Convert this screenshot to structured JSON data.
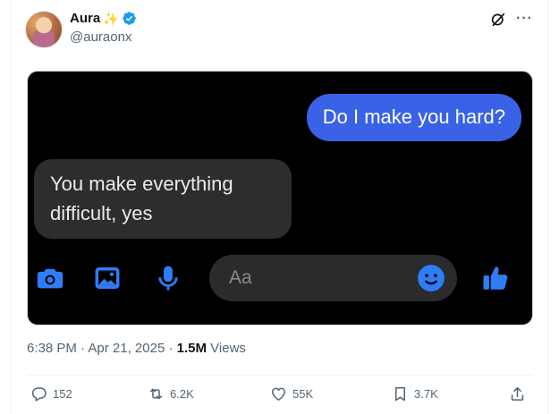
{
  "author": {
    "name": "Aura",
    "handle": "@auraonx"
  },
  "icons": {
    "sparkle": "sparkle-emoji",
    "verified": "verified-badge-icon",
    "grok": "grok-icon",
    "more": "more-icon"
  },
  "media": {
    "sent_message": "Do I make you hard?",
    "received_message": "You make everything difficult, yes",
    "composer_placeholder": "Aa",
    "composer_icons": [
      "camera-icon",
      "image-icon",
      "microphone-icon",
      "emoji-icon",
      "thumbs-up-icon"
    ],
    "colors": {
      "background": "#000000",
      "sent_bubble": "#3a62e6",
      "received_bubble": "#2d2d2f",
      "accent": "#1877f2"
    }
  },
  "meta": {
    "time": "6:38 PM",
    "date": "Apr 21, 2025",
    "views_count": "1.5M",
    "views_label": "Views"
  },
  "actions": {
    "replies": "152",
    "reposts": "6.2K",
    "likes": "55K",
    "bookmarks": "3.7K"
  },
  "colors": {
    "verified": "#1d9bf0",
    "text_primary": "#0f1419",
    "text_secondary": "#536471"
  }
}
